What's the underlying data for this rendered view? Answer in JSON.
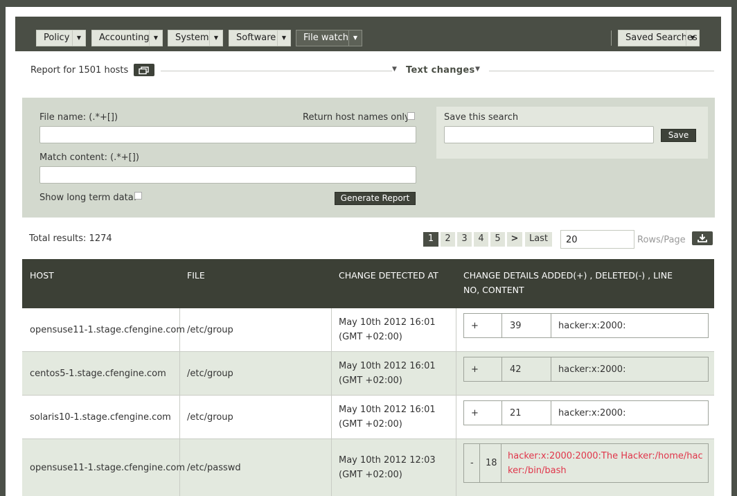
{
  "nav": {
    "items": [
      {
        "label": "Policy"
      },
      {
        "label": "Accounting"
      },
      {
        "label": "System"
      },
      {
        "label": "Software"
      },
      {
        "label": "File watch"
      }
    ],
    "saved_searches": "Saved Searches"
  },
  "report": {
    "hosts_text": "Report for 1501 hosts",
    "section_title": "Text changes"
  },
  "filter": {
    "file_name_label": "File name: (.*+[])",
    "return_hosts_label": "Return host names only:",
    "match_content_label": "Match content: (.*+[])",
    "long_term_label": "Show long term data:",
    "generate_label": "Generate Report",
    "save_search_label": "Save this search",
    "save_label": "Save"
  },
  "results": {
    "total": "Total results: 1274",
    "pages": [
      "1",
      "2",
      "3",
      "4",
      "5"
    ],
    "next": ">",
    "last": "Last",
    "rows_per_page": "20",
    "rows_per_page_label": "Rows/Page"
  },
  "table": {
    "headers": [
      "HOST",
      "FILE",
      "CHANGE DETECTED AT",
      "CHANGE DETAILS ADDED(+) , DELETED(-) , LINE NO, CONTENT"
    ],
    "rows": [
      {
        "host": "opensuse11-1.stage.cfengine.com",
        "file": "/etc/group",
        "time": "May 10th 2012 16:01 (GMT +02:00)",
        "sign": "+",
        "line": "39",
        "content": "hacker:x:2000:"
      },
      {
        "host": "centos5-1.stage.cfengine.com",
        "file": "/etc/group",
        "time": "May 10th 2012 16:01 (GMT +02:00)",
        "sign": "+",
        "line": "42",
        "content": "hacker:x:2000:"
      },
      {
        "host": "solaris10-1.stage.cfengine.com",
        "file": "/etc/group",
        "time": "May 10th 2012 16:01 (GMT +02:00)",
        "sign": "+",
        "line": "21",
        "content": "hacker:x:2000:"
      },
      {
        "host": "opensuse11-1.stage.cfengine.com",
        "file": "/etc/passwd",
        "time": "May 10th 2012 12:03 (GMT +02:00)",
        "sign": "-",
        "line": "18",
        "content": "hacker:x:2000:2000:The Hacker:/home/hacker:/bin/bash"
      }
    ]
  },
  "colors": {
    "header_bg": "#4a4e45",
    "accent_dark": "#3e4239",
    "deleted_text": "#e0354a"
  },
  "icons": {
    "window": "window-icon",
    "download": "download-icon"
  }
}
